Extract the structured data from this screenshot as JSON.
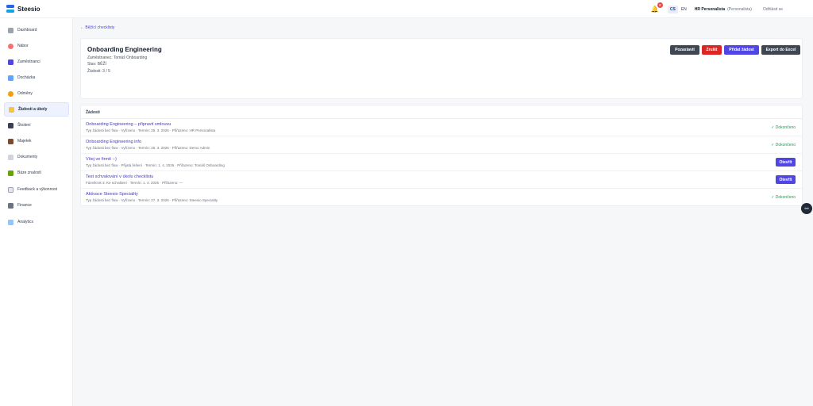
{
  "app": {
    "name": "Steesio"
  },
  "topbar": {
    "notification_count": "8",
    "languages": [
      "CS",
      "EN"
    ],
    "active_language": "CS",
    "user_name": "HR Personalista",
    "user_role": "(Personalista)",
    "logout_label": "Odhlásit se"
  },
  "sidebar": {
    "items": [
      {
        "label": "Dashboard",
        "icon": "dashboard-icon",
        "color": "#9ca3af"
      },
      {
        "label": "Nábor",
        "icon": "target-icon",
        "color": "#f87171"
      },
      {
        "label": "Zaměstnanci",
        "icon": "people-icon",
        "color": "#4f46e5"
      },
      {
        "label": "Docházka",
        "icon": "calendar-icon",
        "color": "#60a5fa"
      },
      {
        "label": "Odměny",
        "icon": "award-icon",
        "color": "#f59e0b"
      },
      {
        "label": "Žádosti a úkoly",
        "icon": "pencil-icon",
        "color": "#f5c542"
      },
      {
        "label": "Školení",
        "icon": "graduation-cap-icon",
        "color": "#374151"
      },
      {
        "label": "Majetek",
        "icon": "briefcase-icon",
        "color": "#7c4a2d"
      },
      {
        "label": "Dokumenty",
        "icon": "document-icon",
        "color": "#d1d5db"
      },
      {
        "label": "Báze znalostí",
        "icon": "books-icon",
        "color": "#65a30d"
      },
      {
        "label": "Feedback a výkonnost",
        "icon": "feedback-icon",
        "color": "#e5e7eb"
      },
      {
        "label": "Finance",
        "icon": "bank-icon",
        "color": "#6b7280"
      },
      {
        "label": "Analytics",
        "icon": "chart-icon",
        "color": "#93c5fd"
      }
    ],
    "active_index": 5
  },
  "main": {
    "back_link": "← Běžící checklisty",
    "header": {
      "title": "Onboarding Engineering",
      "employee": "Zaměstnanec: Tomáš Onboarding",
      "status": "Stav: BĚŽÍ",
      "requests": "Žádosti: 3 / 5",
      "buttons": {
        "postpone": "Pozastavit",
        "cancel": "Zrušit",
        "add_request": "Přidat žádost",
        "export": "Export do Excel"
      }
    },
    "list": {
      "heading": "Žádosti",
      "open_label": "Otevřít",
      "done_label": "✓ Dokončeno",
      "rows": [
        {
          "title": "Onboarding Engineering – připravit smlouvu",
          "subtitle": "Typ žádosti bez flow · Vyřízeno · Termín: 25. 3. 2026 · Přiřazeno: HR Personalista",
          "status": "done"
        },
        {
          "title": "Onboarding Engineering info",
          "subtitle": "Typ žádosti bez flow · Vyřízeno · Termín: 25. 3. 2026 · Přiřazeno: Demo Admin",
          "status": "done"
        },
        {
          "title": "Vítej ve firmě :-)",
          "subtitle": "Typ žádosti bez flow · Přijatá řešení · Termín: 1. 4. 2026 · Přiřazeno: Tomáš Onboarding",
          "status": "open"
        },
        {
          "title": "Test schvalování v úkolu checklistu",
          "subtitle": "Fáze/krok 3: Ke schválení · Termín: 1. 4. 2026 · Přiřazeno: —",
          "status": "open"
        },
        {
          "title": "Aktivace Steesio Speciality",
          "subtitle": "Typ žádosti bez flow · Vyřízeno · Termín: 27. 3. 2026 · Přiřazeno: Steesio Speciality",
          "status": "done"
        }
      ]
    }
  },
  "colors": {
    "accent": "#4f46e5",
    "danger": "#dc2626",
    "success": "#16a34a",
    "dark_button": "#3f4752"
  }
}
